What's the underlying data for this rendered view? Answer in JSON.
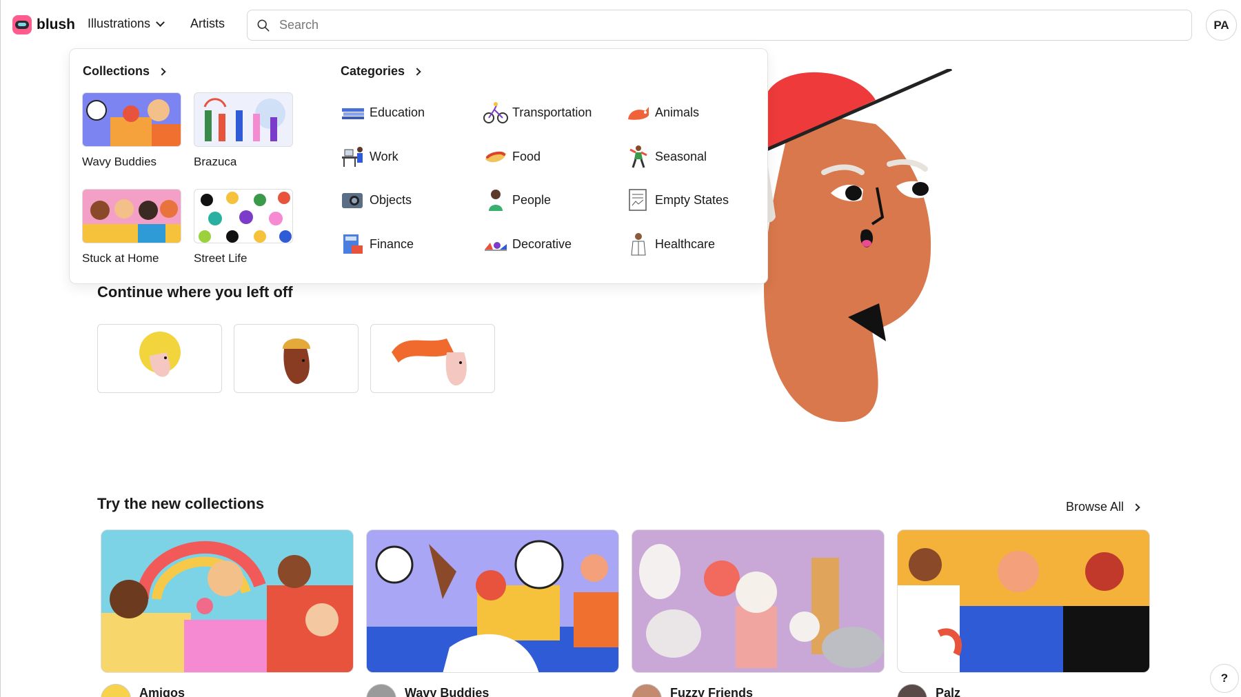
{
  "brand": {
    "name": "blush"
  },
  "nav": {
    "illustrations": "Illustrations",
    "artists": "Artists"
  },
  "search": {
    "placeholder": "Search"
  },
  "user": {
    "initials": "PA"
  },
  "dropdown": {
    "collections_title": "Collections",
    "collections": [
      {
        "label": "Wavy Buddies",
        "icon": "wavy-buddies-thumb"
      },
      {
        "label": "Brazuca",
        "icon": "brazuca-thumb"
      },
      {
        "label": "Stuck at Home",
        "icon": "stuck-at-home-thumb"
      },
      {
        "label": "Street Life",
        "icon": "street-life-thumb"
      }
    ],
    "categories_title": "Categories",
    "categories": [
      {
        "label": "Education",
        "icon": "books-icon"
      },
      {
        "label": "Transportation",
        "icon": "bicycle-icon"
      },
      {
        "label": "Animals",
        "icon": "cat-icon"
      },
      {
        "label": "Work",
        "icon": "desk-worker-icon"
      },
      {
        "label": "Food",
        "icon": "hotdog-icon"
      },
      {
        "label": "Seasonal",
        "icon": "dancing-person-icon"
      },
      {
        "label": "Objects",
        "icon": "camera-icon"
      },
      {
        "label": "People",
        "icon": "person-icon"
      },
      {
        "label": "Empty States",
        "icon": "document-icon"
      },
      {
        "label": "Finance",
        "icon": "calculator-icon"
      },
      {
        "label": "Decorative",
        "icon": "decorative-icon"
      },
      {
        "label": "Healthcare",
        "icon": "doctor-icon"
      }
    ]
  },
  "continue": {
    "title": "Continue where you left off"
  },
  "new_collections": {
    "title": "Try the new collections",
    "browse_all": "Browse All",
    "items": [
      {
        "name": "Amigos"
      },
      {
        "name": "Wavy Buddies"
      },
      {
        "name": "Fuzzy Friends"
      },
      {
        "name": "Palz"
      }
    ]
  },
  "help": {
    "label": "?"
  },
  "colors": {
    "accent": "#ff5b8f",
    "border": "#d6d6d6",
    "hero_red": "#ee3a3a",
    "hero_skin": "#d8784c"
  }
}
